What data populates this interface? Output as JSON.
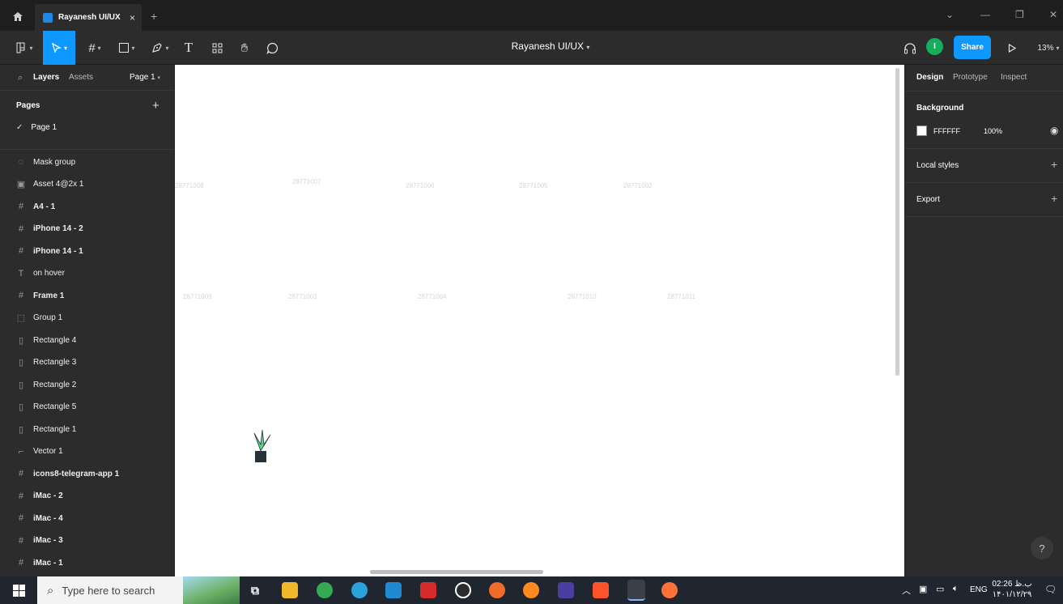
{
  "browser": {
    "tab_title": "Rayanesh UI/UX",
    "tab_close": "×",
    "new_tab": "+",
    "window_controls": [
      "⌄",
      "—",
      "❐",
      "✕"
    ]
  },
  "toolbar": {
    "doc_title": "Rayanesh UI/UX",
    "avatar_initial": "I",
    "share_label": "Share",
    "zoom": "13%"
  },
  "left_panel": {
    "tabs": [
      "Layers",
      "Assets"
    ],
    "page_selector": "Page 1",
    "pages_heading": "Pages",
    "current_page": "Page 1",
    "layers": [
      {
        "name": "Mask group",
        "icon": "mask-icon",
        "glyph": "◌",
        "type": "group"
      },
      {
        "name": "Asset 4@2x 1",
        "icon": "image-icon",
        "glyph": "▣",
        "type": "image"
      },
      {
        "name": "A4 - 1",
        "icon": "frame-icon",
        "glyph": "#",
        "type": "frame"
      },
      {
        "name": "iPhone 14 - 2",
        "icon": "frame-icon",
        "glyph": "#",
        "type": "frame"
      },
      {
        "name": "iPhone 14 - 1",
        "icon": "frame-icon",
        "glyph": "#",
        "type": "frame"
      },
      {
        "name": "on hover",
        "icon": "text-icon",
        "glyph": "T",
        "type": "text"
      },
      {
        "name": "Frame 1",
        "icon": "frame-icon",
        "glyph": "#",
        "type": "frame"
      },
      {
        "name": "Group 1",
        "icon": "group-icon",
        "glyph": "⬚",
        "type": "group"
      },
      {
        "name": "Rectangle 4",
        "icon": "rectangle-icon",
        "glyph": "▯",
        "type": "rect"
      },
      {
        "name": "Rectangle 3",
        "icon": "rectangle-icon",
        "glyph": "▯",
        "type": "rect"
      },
      {
        "name": "Rectangle 2",
        "icon": "rectangle-icon",
        "glyph": "▯",
        "type": "rect"
      },
      {
        "name": "Rectangle 5",
        "icon": "rectangle-icon",
        "glyph": "▯",
        "type": "rect"
      },
      {
        "name": "Rectangle 1",
        "icon": "rectangle-icon",
        "glyph": "▯",
        "type": "rect"
      },
      {
        "name": "Vector 1",
        "icon": "vector-icon",
        "glyph": "⌐",
        "type": "vector"
      },
      {
        "name": "icons8-telegram-app 1",
        "icon": "frame-icon",
        "glyph": "#",
        "type": "frame"
      },
      {
        "name": "iMac - 2",
        "icon": "frame-icon",
        "glyph": "#",
        "type": "frame"
      },
      {
        "name": "iMac - 4",
        "icon": "frame-icon",
        "glyph": "#",
        "type": "frame"
      },
      {
        "name": "iMac - 3",
        "icon": "frame-icon",
        "glyph": "#",
        "type": "frame"
      },
      {
        "name": "iMac - 1",
        "icon": "frame-icon",
        "glyph": "#",
        "type": "frame"
      }
    ]
  },
  "canvas": {
    "illustration_labels": [
      "28771008",
      "28771007",
      "28771006",
      "28771005",
      "28771002",
      "28771009",
      "28771003",
      "28771004",
      "28771010",
      "28771011"
    ],
    "accent_green": "#5ed08b",
    "light_green": "#c9efd6",
    "dark": "#263238"
  },
  "right_panel": {
    "tabs": [
      "Design",
      "Prototype",
      "Inspect"
    ],
    "background_heading": "Background",
    "bg_hex": "FFFFFF",
    "bg_opacity": "100%",
    "local_styles": "Local styles",
    "export": "Export"
  },
  "help_label": "?",
  "taskbar": {
    "search_placeholder": "Type here to search",
    "lang": "ENG",
    "time": "02:26 ب.ظ",
    "date": "۱۴۰۱/۱۲/۲۹"
  }
}
